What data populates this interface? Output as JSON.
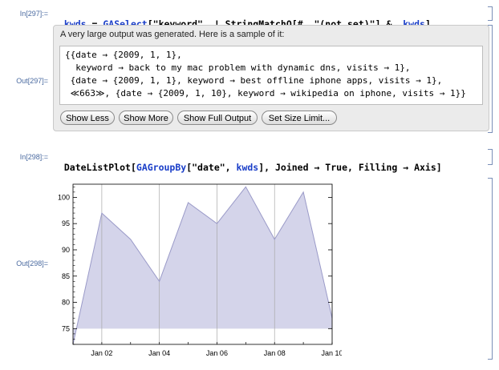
{
  "in1": {
    "label": "In[297]:=",
    "code_parts": [
      "kwds",
      " = ",
      "GASelect",
      "[\"keyword\", ! StringMatchQ[#, \"(not set)\"] &, ",
      "kwds",
      "]"
    ]
  },
  "out1": {
    "label": "Out[297]=",
    "message": "A very large output was generated. Here is a sample of it:",
    "lines": [
      "{{date → {2009, 1, 1},",
      "  keyword → back to my mac problem with dynamic dns, visits → 1},",
      " {date → {2009, 1, 1}, keyword → best offline iphone apps, visits → 1},",
      " ≪663≫, {date → {2009, 1, 10}, keyword → wikipedia on iphone, visits → 1}}"
    ],
    "buttons": [
      "Show Less",
      "Show More",
      "Show Full Output",
      "Set Size Limit..."
    ]
  },
  "in2": {
    "label": "In[298]:=",
    "code_parts": [
      "DateListPlot",
      "[",
      "GAGroupBy",
      "[\"date\", ",
      "kwds",
      "], Joined → True, Filling → Axis]"
    ]
  },
  "out2": {
    "label": "Out[298]="
  },
  "chart_data": {
    "type": "area",
    "x": [
      "2009-01-01",
      "2009-01-02",
      "2009-01-03",
      "2009-01-04",
      "2009-01-05",
      "2009-01-06",
      "2009-01-07",
      "2009-01-08",
      "2009-01-09",
      "2009-01-10"
    ],
    "values": [
      72,
      97,
      92,
      84,
      99,
      95,
      102,
      92,
      101,
      77
    ],
    "ylim": [
      72,
      102.5
    ],
    "yticks": [
      75,
      80,
      85,
      90,
      95,
      100
    ],
    "xtick_labels": [
      "Jan 02",
      "Jan 04",
      "Jan 06",
      "Jan 08",
      "Jan 10"
    ],
    "fill_base": 75,
    "grid": "vertical",
    "fill_color": "#d4d4ea",
    "line_color": "#9a9ac8"
  }
}
